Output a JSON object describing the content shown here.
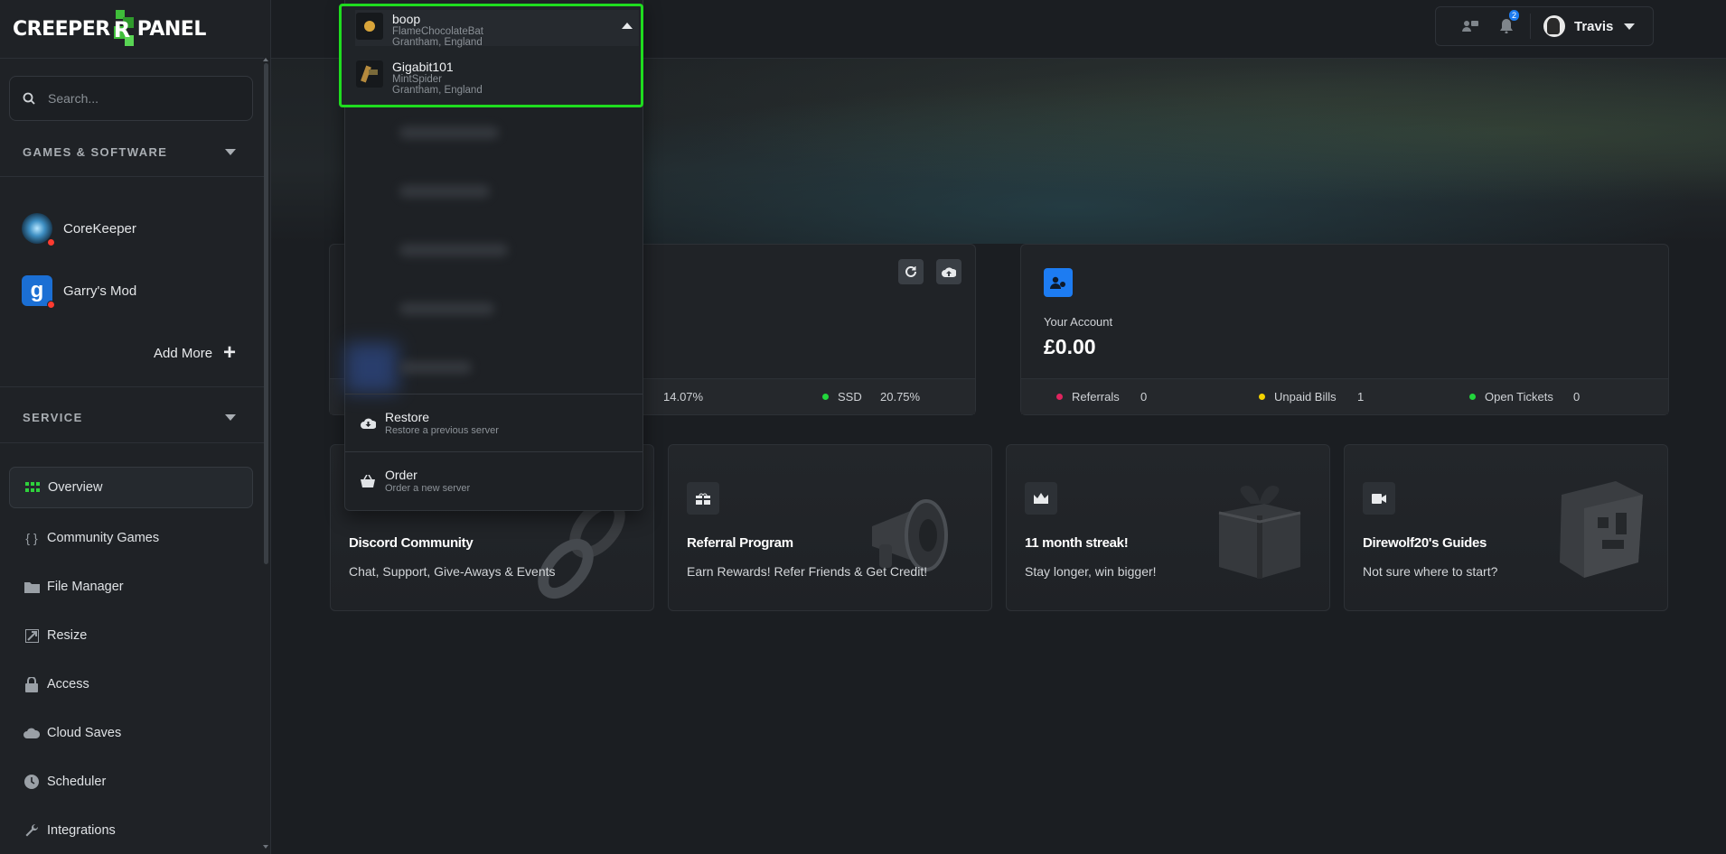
{
  "brand": {
    "left": "CREEPER",
    "right": "PANEL"
  },
  "search": {
    "placeholder": "Search..."
  },
  "sidebar": {
    "games_heading": "GAMES & SOFTWARE",
    "games": [
      {
        "label": "CoreKeeper",
        "icon": "corekeeper-icon"
      },
      {
        "label": "Garry's Mod",
        "icon": "garrysmod-icon"
      }
    ],
    "add_more": "Add More",
    "service_heading": "SERVICE",
    "nav": [
      {
        "label": "Overview",
        "icon": "grid-icon"
      },
      {
        "label": "Community Games",
        "icon": "braces-icon"
      },
      {
        "label": "File Manager",
        "icon": "folder-icon"
      },
      {
        "label": "Resize",
        "icon": "resize-icon"
      },
      {
        "label": "Access",
        "icon": "lock-icon"
      },
      {
        "label": "Cloud Saves",
        "icon": "cloud-icon"
      },
      {
        "label": "Scheduler",
        "icon": "clock-icon"
      },
      {
        "label": "Integrations",
        "icon": "wrench-icon"
      }
    ]
  },
  "topbar": {
    "user_name": "Travis",
    "notification_count": "2"
  },
  "server_dropdown": {
    "servers": [
      {
        "name": "boop",
        "node": "FlameChocolateBat",
        "location": "Grantham, England"
      },
      {
        "name": "Gigabit101",
        "node": "MintSpider",
        "location": "Grantham, England"
      }
    ],
    "actions": [
      {
        "title": "Restore",
        "subtitle": "Restore a previous server"
      },
      {
        "title": "Order",
        "subtitle": "Order a new server"
      }
    ]
  },
  "server_card": {
    "stat_partial": "14.07%",
    "ssd_label": "SSD",
    "ssd_value": "20.75%"
  },
  "account": {
    "label": "Your Account",
    "balance": "£0.00",
    "stats": [
      {
        "label": "Referrals",
        "value": "0",
        "color": "#e0245e"
      },
      {
        "label": "Unpaid Bills",
        "value": "1",
        "color": "#f5d300"
      },
      {
        "label": "Open Tickets",
        "value": "0",
        "color": "#22d63c"
      }
    ]
  },
  "promos": [
    {
      "title": "Discord Community",
      "subtitle": "Chat, Support, Give-Aways & Events"
    },
    {
      "title": "Referral Program",
      "subtitle": "Earn Rewards! Refer Friends & Get Credit!"
    },
    {
      "title": "11 month streak!",
      "subtitle": "Stay longer, win bigger!"
    },
    {
      "title": "Direwolf20's Guides",
      "subtitle": "Not sure where to start?"
    }
  ],
  "colors": {
    "accent": "#1d7cf2",
    "brand_green": "#3fbe3a",
    "highlight": "#1fdc1f",
    "ssd_dot": "#22d63c"
  }
}
